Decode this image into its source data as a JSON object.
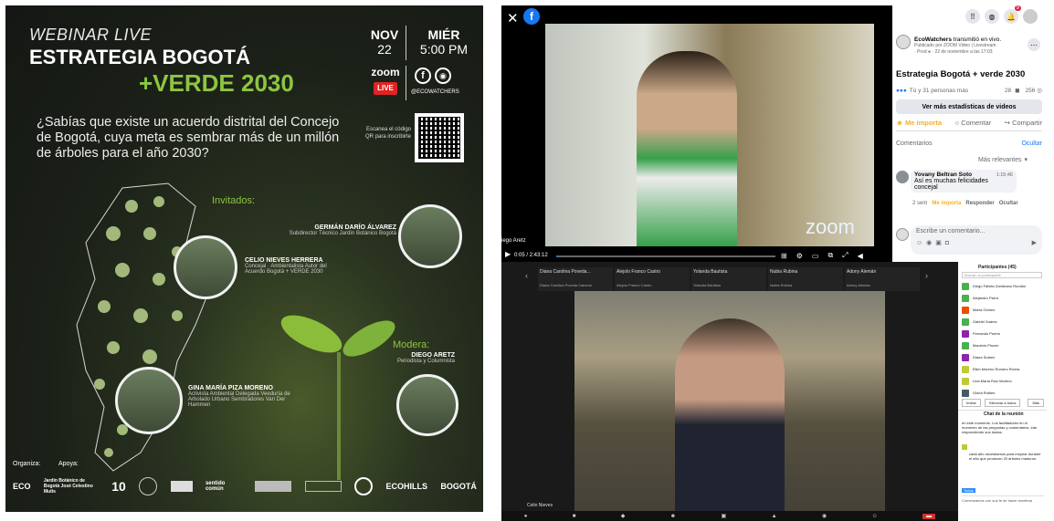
{
  "poster": {
    "kicker": "WEBINAR LIVE",
    "title1": "ESTRATEGIA BOGOTÁ",
    "title2": "+VERDE 2030",
    "month": "NOV",
    "day": "22",
    "weekday": "MIÉR",
    "time": "5:00 PM",
    "zoom": "zoom",
    "live": "LIVE",
    "handle": "@ECOWATCHERS",
    "question": "¿Sabías que existe un acuerdo distrital del Concejo de Bogotá, cuya meta es sembrar más de un millón de árboles para el año 2030?",
    "qr_hint": "Escanea el código QR para inscribirte",
    "guests_label": "Invitados:",
    "g1_name": "GERMÁN DARÍO ÁLVAREZ",
    "g1_role": "Subdirector Técnico Jardín Botánico Bogotá",
    "g2_name": "CELIO NIEVES HERRERA",
    "g2_role": "Concejal · Ambientalista Autor del Acuerdo Bogotá + VERDE 2030",
    "g3_name": "GINA MARÍA PIZA MORENO",
    "g3_role": "Activista Ambiental Delegada Veeduría de Arbolado Urbano Sembradores Van Der Hammen",
    "mod_label": "Modera:",
    "mod_name": "DIEGO ARETZ",
    "mod_role": "Periodista y Columnista",
    "org_label": "Organiza:",
    "sup_label": "Apoya:",
    "logos": [
      "ECO",
      "Jardín Botánico de Bogotá José Celestino Mutis",
      "10",
      "sentido común",
      "ECOHILLS",
      "BOGOTÁ"
    ],
    "colors": {
      "accent": "#8cc63f",
      "live": "#e02424"
    }
  },
  "facebook": {
    "badge_count": "9",
    "video_label": "iego Aretz",
    "time": "0:05 / 2:43:12",
    "zoom_watermark": "zoom",
    "page_name": "EcoWatchers",
    "action": " transmitió en vivo.",
    "sub1": "Publicado por ZOOM Video | Livestream",
    "sub2": "· Prod ● · 22 de noviembre a las 17:03",
    "post_title": "Estrategia Bogotá + verde 2030",
    "reactions": "Tú y 31 personas más",
    "comments_count": "28",
    "views": "256",
    "stats_btn": "Ver más estadísticas de videos",
    "like": "Me importa",
    "comment": "Comentar",
    "share": "Compartir",
    "comments_title": "Comentarios",
    "hide": "Ocultar",
    "sort": "Más relevantes",
    "c_author": "Yovany Beltran Soto",
    "c_time": "1:15:46",
    "c_text": "Así es muchas felicidades concejal",
    "c_age": "2 sem",
    "c_like": "Me importa",
    "c_reply": "Responder",
    "c_hide": "Ocultar",
    "input_placeholder": "Escribe un comentario..."
  },
  "zoom": {
    "thumbs": [
      "Diana Carolina Poveda...",
      "Alejolo Franco Castro",
      "Yolanda Bautista",
      "Nubia Rubina",
      "Adony Alemán"
    ],
    "thumb_sub": [
      "Diana Carolina Poveda Caicedo",
      "Alejolo Franco Castro",
      "Yolanda Bautista",
      "Nubia Rubina",
      "Adony Alemán"
    ],
    "speaker": "Celio Nieves",
    "panel_title": "Participantes (45)",
    "search_placeholder": "Buscar un participante",
    "participants": [
      {
        "name": "Diego Fabián Zambrano Rondón",
        "color": "#4caf50"
      },
      {
        "name": "Alejandro Parra",
        "color": "#4caf50"
      },
      {
        "name": "María Gómez",
        "color": "#e65100"
      },
      {
        "name": "Gabriel Suárez",
        "color": "#4caf50"
      },
      {
        "name": "Fernando Puerto",
        "color": "#8e24aa"
      },
      {
        "name": "Mauricio Pinzón",
        "color": "#4caf50"
      },
      {
        "name": "Diana Suárez",
        "color": "#8e24aa"
      },
      {
        "name": "Elkin Moreno Romero Rivera",
        "color": "#c0ca33"
      },
      {
        "name": "Lina María Ruiz Moreno",
        "color": "#c0ca33"
      },
      {
        "name": "Gloria Robles",
        "color": "#455a64"
      }
    ],
    "btn_invite": "Invitar",
    "btn_mute": "Silenciar a todos",
    "btn_more": "Más",
    "chat_title": "Chat de la reunión",
    "chat_text1": "en este momento. Los facilitadores en el momento de las preguntas y comentarios, irán respondiendo sus dudas.",
    "chat_text2": "cada año necesitamos para mejorar durante el año que producen 20 árboles maduros.",
    "chat_to": "Todos",
    "chat_input": "Comenzamos con sus fe de hacer escritura"
  }
}
